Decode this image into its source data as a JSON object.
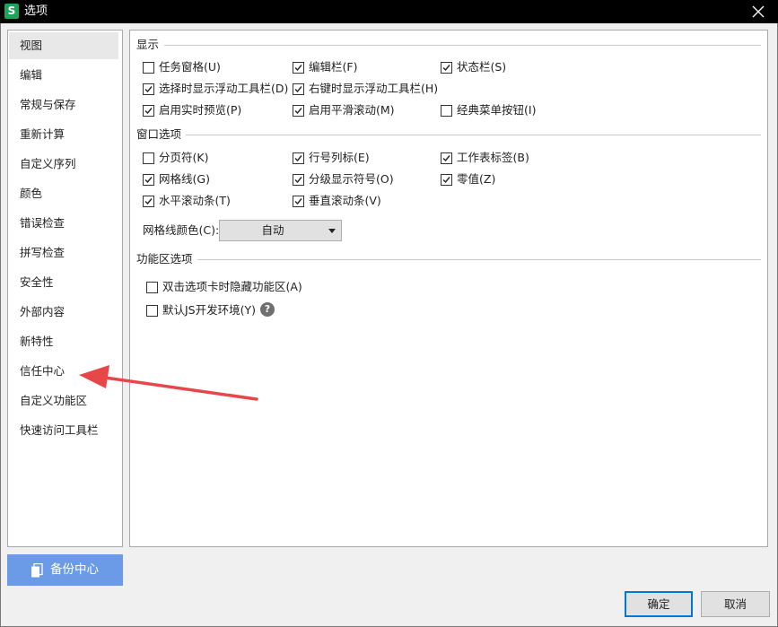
{
  "window": {
    "app_icon_letter": "S",
    "title": "选项"
  },
  "sidebar": {
    "items": [
      {
        "label": "视图",
        "selected": true
      },
      {
        "label": "编辑",
        "selected": false
      },
      {
        "label": "常规与保存",
        "selected": false
      },
      {
        "label": "重新计算",
        "selected": false
      },
      {
        "label": "自定义序列",
        "selected": false
      },
      {
        "label": "颜色",
        "selected": false
      },
      {
        "label": "错误检查",
        "selected": false
      },
      {
        "label": "拼写检查",
        "selected": false
      },
      {
        "label": "安全性",
        "selected": false
      },
      {
        "label": "外部内容",
        "selected": false
      },
      {
        "label": "新特性",
        "selected": false
      },
      {
        "label": "信任中心",
        "selected": false
      },
      {
        "label": "自定义功能区",
        "selected": false
      },
      {
        "label": "快速访问工具栏",
        "selected": false
      }
    ],
    "backup_button": "备份中心"
  },
  "display": {
    "title": "显示",
    "options": [
      {
        "label": "任务窗格(U)",
        "checked": false
      },
      {
        "label": "编辑栏(F)",
        "checked": true
      },
      {
        "label": "状态栏(S)",
        "checked": true
      },
      {
        "label": "选择时显示浮动工具栏(D)",
        "checked": true
      },
      {
        "label": "右键时显示浮动工具栏(H)",
        "checked": true
      },
      {
        "label": "启用实时预览(P)",
        "checked": true
      },
      {
        "label": "启用平滑滚动(M)",
        "checked": true
      },
      {
        "label": "经典菜单按钮(I)",
        "checked": false
      }
    ]
  },
  "window_options": {
    "title": "窗口选项",
    "options": [
      {
        "label": "分页符(K)",
        "checked": false
      },
      {
        "label": "行号列标(E)",
        "checked": true
      },
      {
        "label": "工作表标签(B)",
        "checked": true
      },
      {
        "label": "网格线(G)",
        "checked": true
      },
      {
        "label": "分级显示符号(O)",
        "checked": true
      },
      {
        "label": "零值(Z)",
        "checked": true
      },
      {
        "label": "水平滚动条(T)",
        "checked": true
      },
      {
        "label": "垂直滚动条(V)",
        "checked": true
      }
    ],
    "grid_color_label": "网格线颜色(C):",
    "grid_color_value": "自动"
  },
  "ribbon": {
    "title": "功能区选项",
    "options": [
      {
        "label": "双击选项卡时隐藏功能区(A)",
        "checked": false
      },
      {
        "label": "默认JS开发环境(Y)",
        "checked": false
      }
    ],
    "help_glyph": "?"
  },
  "footer": {
    "ok": "确定",
    "cancel": "取消"
  },
  "colors": {
    "annotation_arrow": "#e8474a",
    "backup_button": "#6b9be6",
    "app_icon": "#1ea35a"
  }
}
